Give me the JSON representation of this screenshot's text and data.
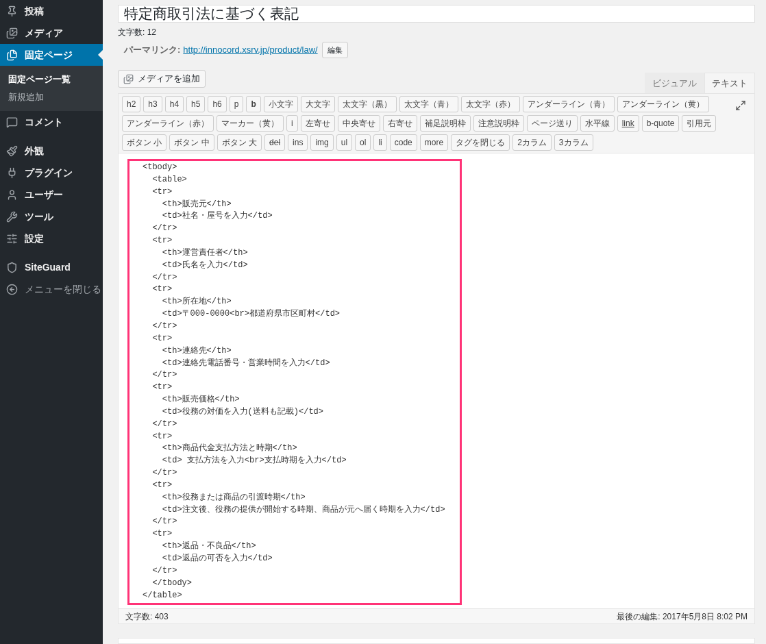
{
  "sidebar": {
    "items": [
      {
        "label": "投稿",
        "selected": false
      },
      {
        "label": "メディア",
        "selected": false
      },
      {
        "label": "固定ページ",
        "selected": true,
        "children": [
          {
            "label": "固定ページ一覧",
            "selected": true
          },
          {
            "label": "新規追加",
            "selected": false
          }
        ]
      },
      {
        "label": "コメント",
        "selected": false
      },
      {
        "label": "外観",
        "selected": false
      },
      {
        "label": "プラグイン",
        "selected": false
      },
      {
        "label": "ユーザー",
        "selected": false
      },
      {
        "label": "ツール",
        "selected": false
      },
      {
        "label": "設定",
        "selected": false
      },
      {
        "label": "SiteGuard",
        "selected": false
      },
      {
        "label": "メニューを閉じる",
        "selected": false
      }
    ]
  },
  "title_field": {
    "value": "特定商取引法に基づく表記"
  },
  "title_count": "文字数: 12",
  "permalink": {
    "label": "パーマリンク:",
    "url": "http://innocord.xsrv.jp/product/law/",
    "edit_button": "編集"
  },
  "add_media_button": "メディアを追加",
  "editor_tabs": [
    {
      "label": "ビジュアル",
      "selected": false
    },
    {
      "label": "テキスト",
      "selected": true
    }
  ],
  "toolbar": {
    "buttons": [
      {
        "label": "h2",
        "kind": "plain"
      },
      {
        "label": "h3",
        "kind": "plain"
      },
      {
        "label": "h4",
        "kind": "plain"
      },
      {
        "label": "h5",
        "kind": "plain"
      },
      {
        "label": "h6",
        "kind": "plain"
      },
      {
        "label": "p",
        "kind": "plain"
      },
      {
        "label": "b",
        "kind": "bold"
      },
      {
        "label": "小文字",
        "kind": "plain"
      },
      {
        "label": "大文字",
        "kind": "plain"
      },
      {
        "label": "太文字（黒）",
        "kind": "plain"
      },
      {
        "label": "太文字（青）",
        "kind": "plain"
      },
      {
        "label": "太文字（赤）",
        "kind": "plain"
      },
      {
        "label": "アンダーライン（青）",
        "kind": "plain"
      },
      {
        "label": "アンダーライン（黄）",
        "kind": "plain"
      },
      {
        "label": "アンダーライン（赤）",
        "kind": "plain"
      },
      {
        "label": "マーカー（黄）",
        "kind": "plain"
      },
      {
        "label": "i",
        "kind": "plain"
      },
      {
        "label": "左寄せ",
        "kind": "plain"
      },
      {
        "label": "中央寄せ",
        "kind": "plain"
      },
      {
        "label": "右寄せ",
        "kind": "plain"
      },
      {
        "label": "補足説明枠",
        "kind": "plain"
      },
      {
        "label": "注意説明枠",
        "kind": "plain"
      },
      {
        "label": "ページ送り",
        "kind": "plain"
      },
      {
        "label": "水平線",
        "kind": "plain"
      },
      {
        "label": "link",
        "kind": "underline"
      },
      {
        "label": "b-quote",
        "kind": "plain"
      },
      {
        "label": "引用元",
        "kind": "plain"
      },
      {
        "label": "ボタン 小",
        "kind": "plain"
      },
      {
        "label": "ボタン 中",
        "kind": "plain"
      },
      {
        "label": "ボタン 大",
        "kind": "plain"
      },
      {
        "label": "del",
        "kind": "strike"
      },
      {
        "label": "ins",
        "kind": "plain"
      },
      {
        "label": "img",
        "kind": "plain"
      },
      {
        "label": "ul",
        "kind": "plain"
      },
      {
        "label": "ol",
        "kind": "plain"
      },
      {
        "label": "li",
        "kind": "plain"
      },
      {
        "label": "code",
        "kind": "plain"
      },
      {
        "label": "more",
        "kind": "plain"
      },
      {
        "label": "タグを閉じる",
        "kind": "plain"
      },
      {
        "label": "2カラム",
        "kind": "plain"
      },
      {
        "label": "3カラム",
        "kind": "plain"
      }
    ]
  },
  "code_lines": [
    "<tbody>",
    "  <table>",
    "  <tr>",
    "    <th>販売元</th>",
    "    <td>社名・屋号を入力</td>",
    "  </tr>",
    "  <tr>",
    "    <th>運営責任者</th>",
    "    <td>氏名を入力</td>",
    "  </tr>",
    "  <tr>",
    "    <th>所在地</th>",
    "    <td>〒000-0000<br>都道府県市区町村</td>",
    "  </tr>",
    "  <tr>",
    "    <th>連絡先</th>",
    "    <td>連絡先電話番号・営業時間を入力</td>",
    "  </tr>",
    "  <tr>",
    "    <th>販売価格</th>",
    "    <td>役務の対価を入力(送料も記載)</td>",
    "  </tr>",
    "  <tr>",
    "    <th>商品代金支払方法と時期</th>",
    "    <td> 支払方法を入力<br>支払時期を入力</td>",
    "  </tr>",
    "  <tr>",
    "    <th>役務または商品の引渡時期</th>",
    "    <td>注文後、役務の提供が開始する時期、商品が元へ届く時期を入力</td>",
    "  </tr>",
    "  <tr>",
    "    <th>返品・不良品</th>",
    "    <td>返品の可否を入力</td>",
    "  </tr>",
    "  </tbody>",
    "</table>"
  ],
  "status_bar": {
    "word_count": "文字数: 403",
    "last_edited": "最後の編集: 2017年5月8日 8:02 PM"
  }
}
